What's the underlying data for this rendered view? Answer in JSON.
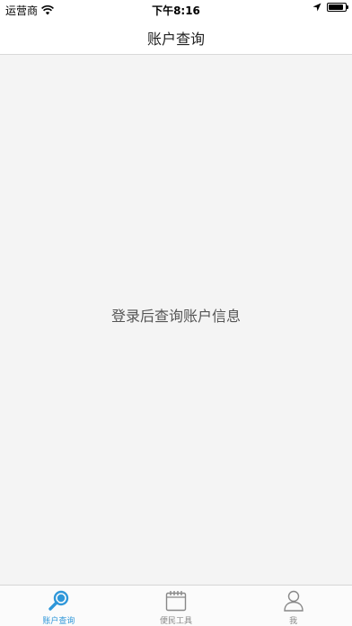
{
  "status_bar": {
    "carrier": "运营商",
    "time": "下午8:16",
    "battery_level": 0.9
  },
  "nav": {
    "title": "账户查询"
  },
  "main": {
    "empty_message": "登录后查询账户信息"
  },
  "tab_bar": {
    "tabs": [
      {
        "label": "账户查询",
        "icon": "magnifier-icon",
        "active": true
      },
      {
        "label": "便民工具",
        "icon": "calendar-icon",
        "active": false
      },
      {
        "label": "我",
        "icon": "user-icon",
        "active": false
      }
    ]
  },
  "colors": {
    "accent": "#2f97d9",
    "inactive": "#888888",
    "background": "#f4f4f4"
  }
}
